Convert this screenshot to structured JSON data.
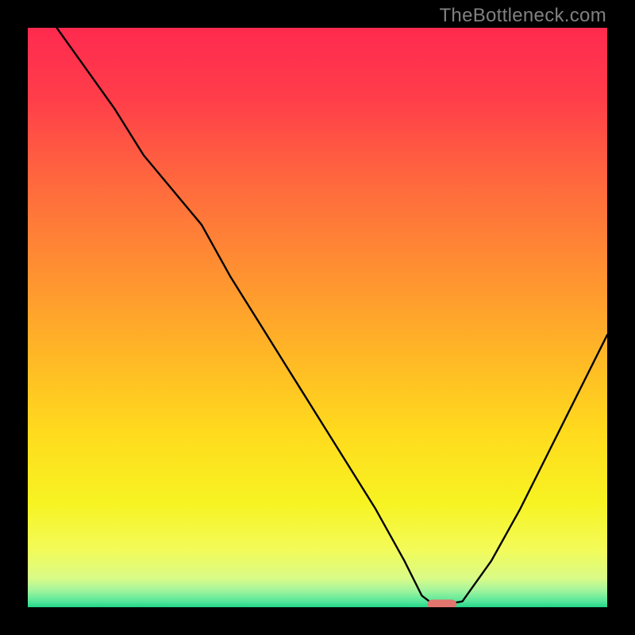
{
  "watermark": "TheBottleneck.com",
  "chart_data": {
    "type": "line",
    "title": "",
    "xlabel": "",
    "ylabel": "",
    "xlim": [
      0,
      100
    ],
    "ylim": [
      0,
      100
    ],
    "series": [
      {
        "name": "bottleneck-curve",
        "x": [
          5,
          10,
          15,
          20,
          25,
          30,
          35,
          40,
          45,
          50,
          55,
          60,
          65,
          68,
          70,
          72,
          75,
          80,
          85,
          90,
          95,
          100
        ],
        "values": [
          100,
          93,
          86,
          78,
          72,
          66,
          57,
          49,
          41,
          33,
          25,
          17,
          8,
          2,
          0.5,
          0.5,
          1,
          8,
          17,
          27,
          37,
          47
        ]
      }
    ],
    "highlight": {
      "x_start": 69,
      "x_end": 74,
      "y": 0.5,
      "color": "#e2746e"
    },
    "gradient_stops": [
      {
        "offset": 0,
        "color": "#ff2a4f"
      },
      {
        "offset": 12,
        "color": "#ff3d4a"
      },
      {
        "offset": 25,
        "color": "#ff643f"
      },
      {
        "offset": 40,
        "color": "#ff8b33"
      },
      {
        "offset": 55,
        "color": "#ffb327"
      },
      {
        "offset": 70,
        "color": "#ffdb1d"
      },
      {
        "offset": 82,
        "color": "#f7f322"
      },
      {
        "offset": 90,
        "color": "#f3fb58"
      },
      {
        "offset": 95,
        "color": "#d9fb87"
      },
      {
        "offset": 97,
        "color": "#a6f59c"
      },
      {
        "offset": 99,
        "color": "#55e79a"
      },
      {
        "offset": 100,
        "color": "#22d688"
      }
    ]
  }
}
